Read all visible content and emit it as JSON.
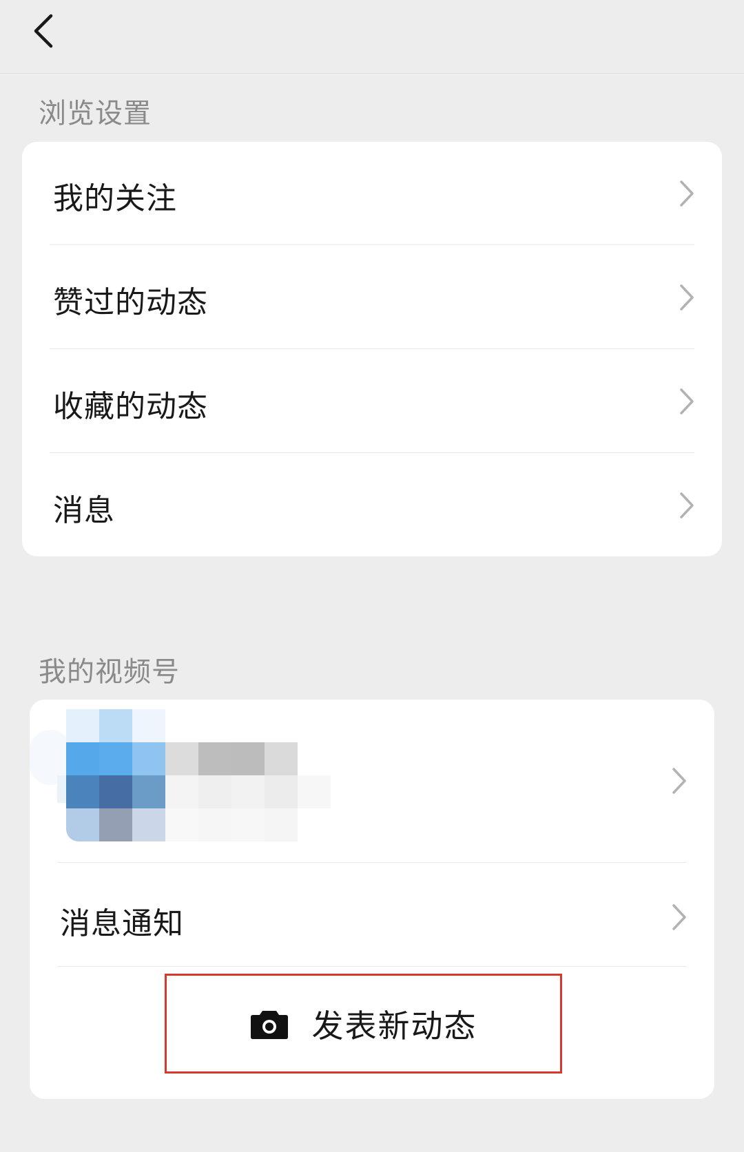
{
  "header": {
    "back_icon": "chevron-left-icon"
  },
  "browse_section": {
    "title": "浏览设置",
    "items": [
      {
        "label": "我的关注"
      },
      {
        "label": "赞过的动态"
      },
      {
        "label": "收藏的动态"
      },
      {
        "label": "消息"
      }
    ]
  },
  "channel_section": {
    "title": "我的视频号",
    "profile_row": {
      "avatar_note": "pixelated-avatar"
    },
    "items": [
      {
        "label": "消息通知"
      }
    ],
    "post_button": {
      "label": "发表新动态",
      "icon": "camera-icon"
    }
  },
  "colors": {
    "background": "#ededed",
    "card": "#ffffff",
    "highlight_border": "#d9362c"
  }
}
